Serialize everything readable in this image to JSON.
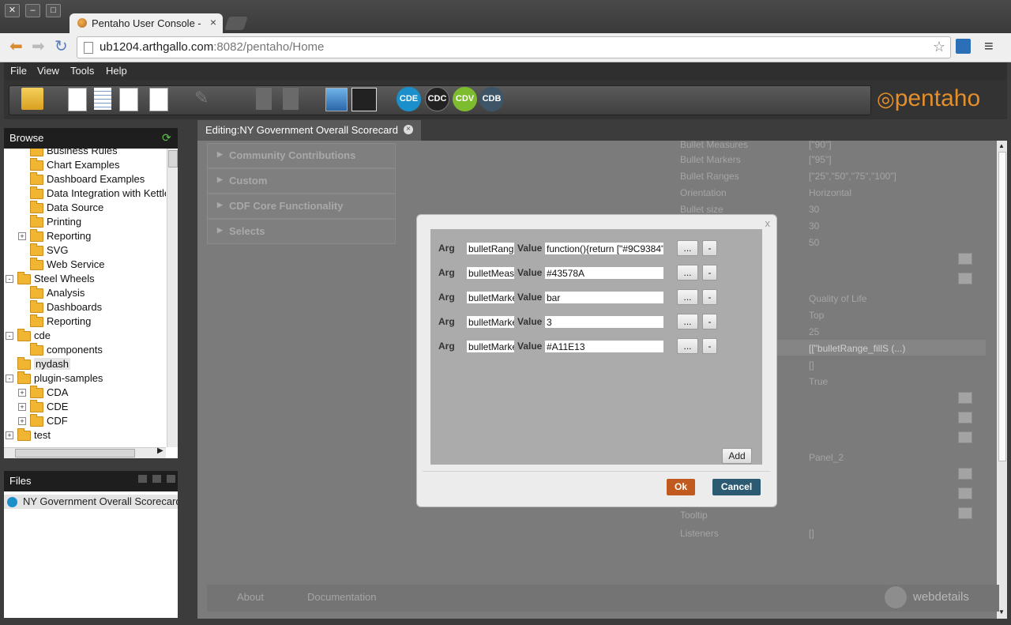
{
  "browser": {
    "tab_title": "Pentaho User Console - Ed",
    "url_host": "ub1204.arthgallo.com",
    "url_rest": ":8082/pentaho/Home"
  },
  "menu": [
    "File",
    "View",
    "Tools",
    "Help"
  ],
  "toolbar": {
    "circles": [
      {
        "label": "CDE",
        "color": "#1b8fc9"
      },
      {
        "label": "CDC",
        "color": "#222222"
      },
      {
        "label": "CDV",
        "color": "#7dbb2f"
      },
      {
        "label": "CDB",
        "color": "#3d5566"
      }
    ],
    "logo": "pentaho"
  },
  "browse": {
    "title": "Browse",
    "items": [
      {
        "label": "Business Rules",
        "level": 2
      },
      {
        "label": "Chart Examples",
        "level": 2
      },
      {
        "label": "Dashboard Examples",
        "level": 2
      },
      {
        "label": "Data Integration with Kettle",
        "level": 2
      },
      {
        "label": "Data Source",
        "level": 2
      },
      {
        "label": "Printing",
        "level": 2
      },
      {
        "label": "Reporting",
        "level": 2,
        "expander": "+"
      },
      {
        "label": "SVG",
        "level": 2
      },
      {
        "label": "Web Service",
        "level": 2
      },
      {
        "label": "Steel Wheels",
        "level": 1,
        "expander": "-"
      },
      {
        "label": "Analysis",
        "level": 2
      },
      {
        "label": "Dashboards",
        "level": 2
      },
      {
        "label": "Reporting",
        "level": 2
      },
      {
        "label": "cde",
        "level": 1,
        "expander": "-"
      },
      {
        "label": "components",
        "level": 2
      },
      {
        "label": "nydash",
        "level": 1
      },
      {
        "label": "plugin-samples",
        "level": 1,
        "expander": "-"
      },
      {
        "label": "CDA",
        "level": 2,
        "expander": "+"
      },
      {
        "label": "CDE",
        "level": 2,
        "expander": "+"
      },
      {
        "label": "CDF",
        "level": 2,
        "expander": "+"
      },
      {
        "label": "test",
        "level": 1,
        "expander": "+"
      }
    ]
  },
  "files": {
    "title": "Files",
    "items": [
      "NY Government Overall Scorecard"
    ]
  },
  "editor": {
    "tab_label": "Editing:NY Government Overall Scorecard",
    "accordion": [
      "Community Contributions",
      "Custom",
      "CDF Core Functionality",
      "Selects"
    ],
    "properties": [
      {
        "label": "Bullet Measures",
        "value": "[\"90\"]"
      },
      {
        "label": "Bullet Markers",
        "value": "[\"95\"]"
      },
      {
        "label": "Bullet Ranges",
        "value": "[\"25\",\"50\",\"75\",\"100\"]"
      },
      {
        "label": "Orientation",
        "value": "Horizontal"
      },
      {
        "label": "Bullet size",
        "value": "30"
      },
      {
        "label": "",
        "value": "30"
      },
      {
        "label": "",
        "value": "50"
      },
      {
        "label": "",
        "value": "Quality of Life"
      },
      {
        "label": "",
        "value": "Top"
      },
      {
        "label": "",
        "value": "25"
      },
      {
        "label": "",
        "value": "[[\"bulletRange_fillS (...)"
      },
      {
        "label": "",
        "value": "[]"
      },
      {
        "label": "",
        "value": "True"
      },
      {
        "label": "",
        "value": "Panel_2"
      },
      {
        "label": "Tooltip",
        "value": ""
      },
      {
        "label": "Listeners",
        "value": "[]"
      }
    ],
    "footer": {
      "about": "About",
      "docs": "Documentation",
      "brand": "webdetails"
    }
  },
  "dialog": {
    "arg_label": "Arg",
    "value_label": "Value",
    "rows": [
      {
        "arg": "bulletRang",
        "value": "function(){return [\"#9C9384\""
      },
      {
        "arg": "bulletMeas",
        "value": "#43578A"
      },
      {
        "arg": "bulletMarke",
        "value": "bar"
      },
      {
        "arg": "bulletMarke",
        "value": "3"
      },
      {
        "arg": "bulletMarke",
        "value": "#A11E13"
      }
    ],
    "dots_label": "...",
    "remove_label": "-",
    "add_label": "Add",
    "ok_label": "Ok",
    "cancel_label": "Cancel",
    "close_label": "x"
  }
}
